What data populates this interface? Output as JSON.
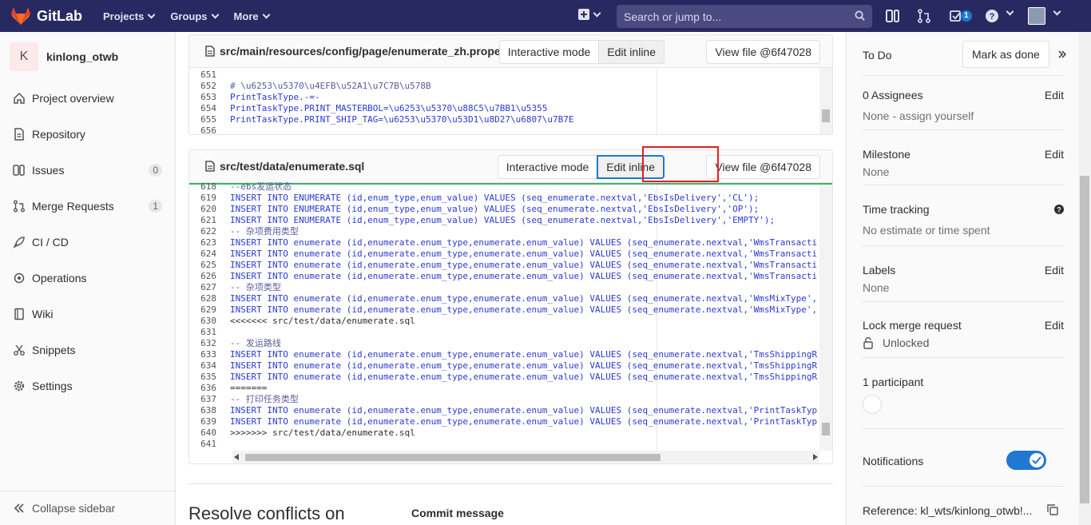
{
  "navbar": {
    "brand": "GitLab",
    "links": [
      {
        "label": "Projects"
      },
      {
        "label": "Groups"
      },
      {
        "label": "More"
      }
    ],
    "search_placeholder": "Search or jump to...",
    "todo_count": "1"
  },
  "sidebar": {
    "project_initial": "K",
    "project_name": "kinlong_otwb",
    "items": [
      {
        "label": "Project overview",
        "icon": "home-icon"
      },
      {
        "label": "Repository",
        "icon": "doc-icon"
      },
      {
        "label": "Issues",
        "icon": "issues-icon",
        "count": "0"
      },
      {
        "label": "Merge Requests",
        "icon": "merge-request-icon",
        "count": "1"
      },
      {
        "label": "CI / CD",
        "icon": "rocket-icon"
      },
      {
        "label": "Operations",
        "icon": "cloud-gear-icon"
      },
      {
        "label": "Wiki",
        "icon": "book-icon"
      },
      {
        "label": "Snippets",
        "icon": "scissors-icon"
      },
      {
        "label": "Settings",
        "icon": "settings-icon"
      }
    ],
    "collapse_label": "Collapse sidebar"
  },
  "files": [
    {
      "path": "src/main/resources/config/page/enumerate_zh.properties",
      "btn_interactive": "Interactive mode",
      "btn_edit": "Edit inline",
      "btn_view": "View file @6f47028",
      "lines": [
        {
          "n": "651",
          "t": ""
        },
        {
          "n": "652",
          "t": "# \\u6253\\u5370\\u4EFB\\u52A1\\u7C7B\\u578B"
        },
        {
          "n": "653",
          "t": "PrintTaskType.-=-"
        },
        {
          "n": "654",
          "t": "PrintTaskType.PRINT_MASTERBOL=\\u6253\\u5370\\u88C5\\u7BB1\\u5355"
        },
        {
          "n": "655",
          "t": "PrintTaskType.PRINT_SHIP_TAG=\\u6253\\u5370\\u53D1\\u8D27\\u6807\\u7B7E"
        },
        {
          "n": "656",
          "t": ""
        }
      ]
    },
    {
      "path": "src/test/data/enumerate.sql",
      "btn_interactive": "Interactive mode",
      "btn_edit": "Edit inline",
      "btn_view": "View file @6f47028",
      "lines": [
        {
          "n": "618",
          "t": "--ebs发运状态"
        },
        {
          "n": "619",
          "t": "INSERT INTO ENUMERATE (id,enum_type,enum_value) VALUES (seq_enumerate.nextval,'EbsIsDelivery','CL');"
        },
        {
          "n": "620",
          "t": "INSERT INTO ENUMERATE (id,enum_type,enum_value) VALUES (seq_enumerate.nextval,'EbsIsDelivery','OP');"
        },
        {
          "n": "621",
          "t": "INSERT INTO ENUMERATE (id,enum_type,enum_value) VALUES (seq_enumerate.nextval,'EbsIsDelivery','EMPTY');"
        },
        {
          "n": "622",
          "t": "-- 杂项费用类型"
        },
        {
          "n": "623",
          "t": "INSERT INTO enumerate (id,enumerate.enum_type,enumerate.enum_value) VALUES (seq_enumerate.nextval,'WmsTransacti"
        },
        {
          "n": "624",
          "t": "INSERT INTO enumerate (id,enumerate.enum_type,enumerate.enum_value) VALUES (seq_enumerate.nextval,'WmsTransacti"
        },
        {
          "n": "625",
          "t": "INSERT INTO enumerate (id,enumerate.enum_type,enumerate.enum_value) VALUES (seq_enumerate.nextval,'WmsTransacti"
        },
        {
          "n": "626",
          "t": "INSERT INTO enumerate (id,enumerate.enum_type,enumerate.enum_value) VALUES (seq_enumerate.nextval,'WmsTransacti"
        },
        {
          "n": "627",
          "t": "-- 杂项类型"
        },
        {
          "n": "628",
          "t": "INSERT INTO enumerate (id,enumerate.enum_type,enumerate.enum_value) VALUES (seq_enumerate.nextval,'WmsMixType',"
        },
        {
          "n": "629",
          "t": "INSERT INTO enumerate (id,enumerate.enum_type,enumerate.enum_value) VALUES (seq_enumerate.nextval,'WmsMixType',"
        },
        {
          "n": "630",
          "t": "<<<<<<< src/test/data/enumerate.sql"
        },
        {
          "n": "631",
          "t": ""
        },
        {
          "n": "632",
          "t": "-- 发运路线"
        },
        {
          "n": "633",
          "t": "INSERT INTO enumerate (id,enumerate.enum_type,enumerate.enum_value) VALUES (seq_enumerate.nextval,'TmsShippingR"
        },
        {
          "n": "634",
          "t": "INSERT INTO enumerate (id,enumerate.enum_type,enumerate.enum_value) VALUES (seq_enumerate.nextval,'TmsShippingR"
        },
        {
          "n": "635",
          "t": "INSERT INTO enumerate (id,enumerate.enum_type,enumerate.enum_value) VALUES (seq_enumerate.nextval,'TmsShippingR"
        },
        {
          "n": "636",
          "t": "======="
        },
        {
          "n": "637",
          "t": "-- 打印任务类型"
        },
        {
          "n": "638",
          "t": "INSERT INTO enumerate (id,enumerate.enum_type,enumerate.enum_value) VALUES (seq_enumerate.nextval,'PrintTaskTyp"
        },
        {
          "n": "639",
          "t": "INSERT INTO enumerate (id,enumerate.enum_type,enumerate.enum_value) VALUES (seq_enumerate.nextval,'PrintTaskTyp"
        },
        {
          "n": "640",
          "t": ">>>>>>> src/test/data/enumerate.sql"
        },
        {
          "n": "641",
          "t": ""
        }
      ]
    }
  ],
  "resolve_heading": "Resolve conflicts on",
  "commit_message_label": "Commit message",
  "rightbar": {
    "todo_label": "To Do",
    "mark_done": "Mark as done",
    "assignees_title": "0 Assignees",
    "assignees_value": "None - assign yourself",
    "milestone_title": "Milestone",
    "milestone_value": "None",
    "time_title": "Time tracking",
    "time_value": "No estimate or time spent",
    "labels_title": "Labels",
    "labels_value": "None",
    "lock_title": "Lock merge request",
    "lock_value": "Unlocked",
    "participants_title": "1 participant",
    "notifications_title": "Notifications",
    "notifications_on": true,
    "reference": "Reference: kl_wts/kinlong_otwb!...",
    "edit_label": "Edit"
  }
}
